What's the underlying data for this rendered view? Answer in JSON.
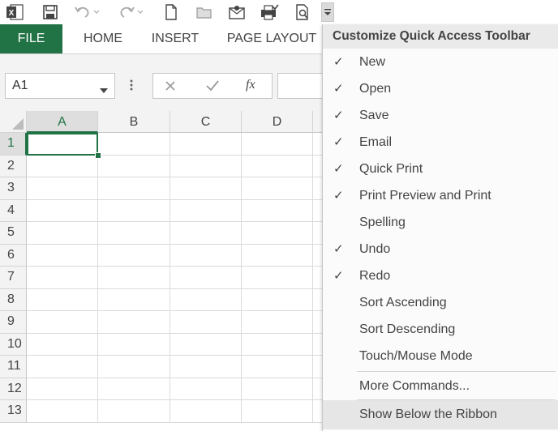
{
  "tabs": [
    {
      "label": "FILE"
    },
    {
      "label": "HOME"
    },
    {
      "label": "INSERT"
    },
    {
      "label": "PAGE LAYOUT"
    }
  ],
  "formula_bar": {
    "name_box_value": "A1",
    "fx_label": "fx",
    "formula_value": ""
  },
  "grid": {
    "columns": [
      "A",
      "B",
      "C",
      "D"
    ],
    "rows": [
      "1",
      "2",
      "3",
      "4",
      "5",
      "6",
      "7",
      "8",
      "9",
      "10",
      "11",
      "12",
      "13"
    ],
    "active_cell": "A1"
  },
  "menu": {
    "title": "Customize Quick Access Toolbar",
    "items": [
      {
        "label": "New",
        "checked": true
      },
      {
        "label": "Open",
        "checked": true
      },
      {
        "label": "Save",
        "checked": true
      },
      {
        "label": "Email",
        "checked": true
      },
      {
        "label": "Quick Print",
        "checked": true
      },
      {
        "label": "Print Preview and Print",
        "checked": true
      },
      {
        "label": "Spelling",
        "checked": false
      },
      {
        "label": "Undo",
        "checked": true
      },
      {
        "label": "Redo",
        "checked": true
      },
      {
        "label": "Sort Ascending",
        "checked": false
      },
      {
        "label": "Sort Descending",
        "checked": false
      },
      {
        "label": "Touch/Mouse Mode",
        "checked": false
      }
    ],
    "more_commands": "More Commands...",
    "show_below": "Show Below the Ribbon",
    "check_glyph": "✓"
  },
  "icons": {
    "excel": "excel-logo-icon",
    "save": "save-icon",
    "undo": "undo-icon",
    "redo": "redo-icon",
    "new": "new-document-icon",
    "open": "open-folder-icon",
    "email": "email-icon",
    "quick_print": "quick-print-icon",
    "print_preview": "print-preview-icon",
    "customize": "customize-dropdown-icon"
  },
  "colors": {
    "accent": "#217346",
    "menu_bg": "#fbfbfb",
    "menu_title_bg": "#eaeaea"
  }
}
